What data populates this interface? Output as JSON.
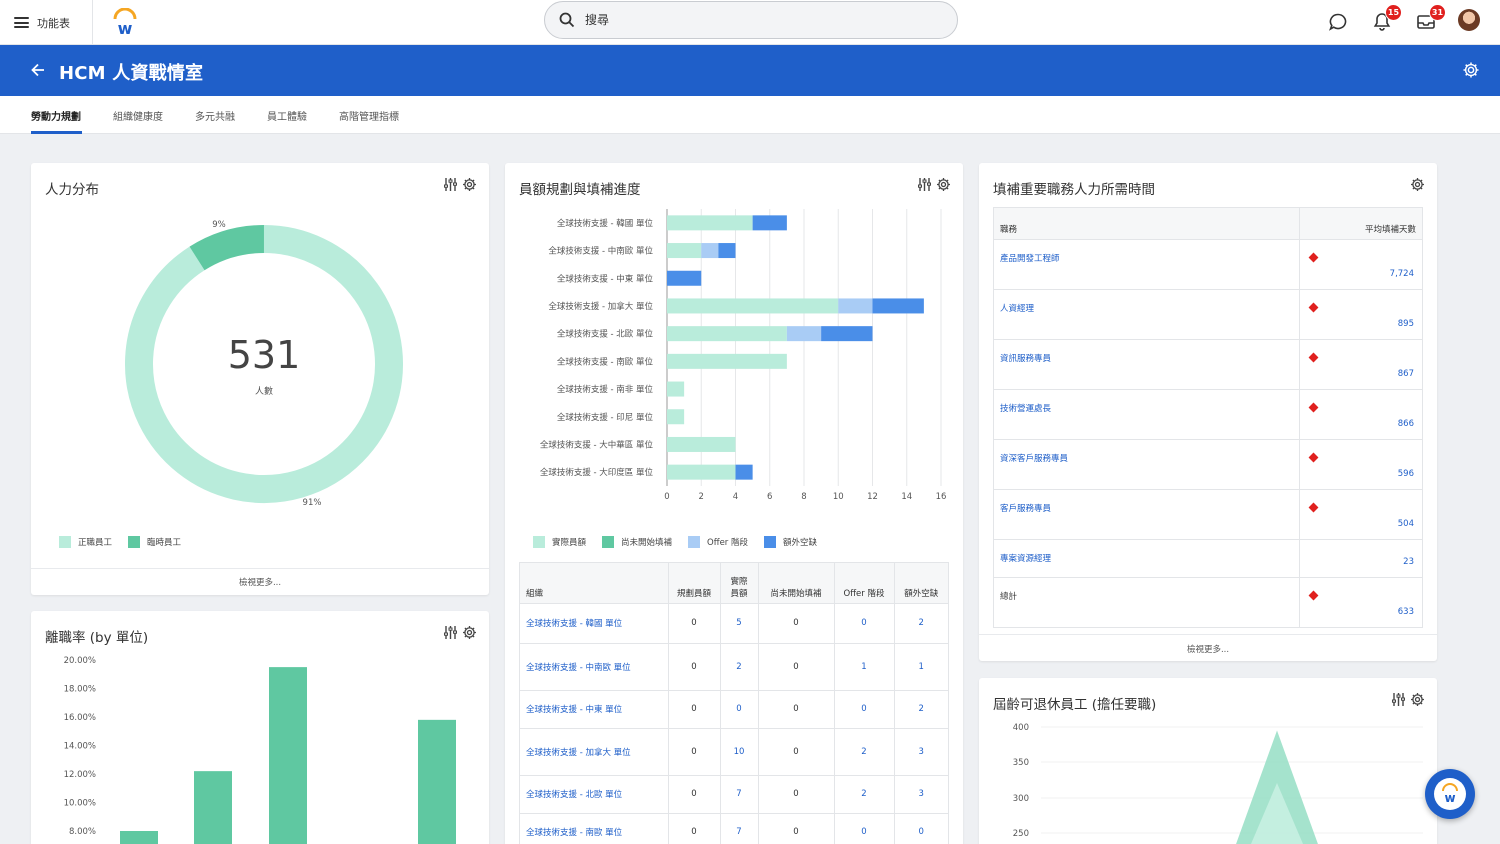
{
  "topbar": {
    "menu_label": "功能表",
    "search_placeholder": "搜尋",
    "notifications_count": "15",
    "inbox_count": "31"
  },
  "header": {
    "title": "HCM 人資戰情室"
  },
  "tabs": [
    {
      "label": "勞動力規劃",
      "active": true
    },
    {
      "label": "組織健康度"
    },
    {
      "label": "多元共融"
    },
    {
      "label": "員工體驗"
    },
    {
      "label": "高階管理指標"
    }
  ],
  "headcount": {
    "title": "人力分布",
    "total": "531",
    "total_label": "人數",
    "slices": [
      {
        "name": "正職員工",
        "pct": 91,
        "label": "91%",
        "color": "#b9ecdb"
      },
      {
        "name": "臨時員工",
        "pct": 9,
        "label": "9%",
        "color": "#5fc8a1"
      }
    ],
    "more": "檢視更多..."
  },
  "hiring": {
    "title": "員額規劃與填補進度",
    "chart_data": {
      "type": "bar",
      "orientation": "horizontal",
      "stacked": true,
      "categories": [
        "全球技術支援 - 韓國 單位",
        "全球技術支援 - 中南歐 單位",
        "全球技術支援 - 中東 單位",
        "全球技術支援 - 加拿大 單位",
        "全球技術支援 - 北歐 單位",
        "全球技術支援 - 南歐 單位",
        "全球技術支援 - 南非 單位",
        "全球技術支援 - 印尼 單位",
        "全球技術支援 - 大中華區 單位",
        "全球技術支援 - 大印度區 單位"
      ],
      "series": [
        {
          "name": "實際員額",
          "color": "#b9ecdb",
          "values": [
            5,
            2,
            0,
            10,
            7,
            7,
            1,
            1,
            4,
            4
          ]
        },
        {
          "name": "尚未開始填補",
          "color": "#5fc8a1",
          "values": [
            0,
            0,
            0,
            0,
            0,
            0,
            0,
            0,
            0,
            0
          ]
        },
        {
          "name": "Offer 階段",
          "color": "#a9ccf5",
          "values": [
            0,
            1,
            0,
            2,
            2,
            0,
            0,
            0,
            0,
            0
          ]
        },
        {
          "name": "額外空缺",
          "color": "#4a8ee8",
          "values": [
            2,
            1,
            2,
            3,
            3,
            0,
            0,
            0,
            0,
            1
          ]
        }
      ],
      "xticks": [
        0,
        2,
        4,
        6,
        8,
        10,
        12,
        14,
        16
      ],
      "xlim": [
        0,
        16
      ],
      "grid": true,
      "legend": "bottom"
    },
    "table": {
      "headers": [
        "組織",
        "規劃員額",
        "實際員額",
        "尚未開始填補",
        "Offer 階段",
        "額外空缺"
      ],
      "rows": [
        [
          "全球技術支援 - 韓國 單位",
          "0",
          "5",
          "0",
          "0",
          "2"
        ],
        [
          "全球技術支援 - 中南歐 單位",
          "0",
          "2",
          "0",
          "1",
          "1"
        ],
        [
          "全球技術支援 - 中東 單位",
          "0",
          "0",
          "0",
          "0",
          "2"
        ],
        [
          "全球技術支援 - 加拿大 單位",
          "0",
          "10",
          "0",
          "2",
          "3"
        ],
        [
          "全球技術支援 - 北歐 單位",
          "0",
          "7",
          "0",
          "2",
          "3"
        ],
        [
          "全球技術支援 - 南歐 單位",
          "0",
          "7",
          "0",
          "0",
          "0"
        ]
      ]
    }
  },
  "timetofill": {
    "title": "填補重要職務人力所需時間",
    "headers": [
      "職務",
      "平均填補天數"
    ],
    "rows": [
      {
        "role": "產品開發工程師",
        "days": "7,724",
        "flag": true
      },
      {
        "role": "人資經理",
        "days": "895",
        "flag": true
      },
      {
        "role": "資訊服務專員",
        "days": "867",
        "flag": true
      },
      {
        "role": "技術營運處長",
        "days": "866",
        "flag": true
      },
      {
        "role": "資深客戶服務專員",
        "days": "596",
        "flag": true
      },
      {
        "role": "客戶服務專員",
        "days": "504",
        "flag": true
      },
      {
        "role": "專案資源經理",
        "days": "23",
        "flag": false
      },
      {
        "role": "總計",
        "days": "633",
        "flag": true
      }
    ],
    "more": "檢視更多..."
  },
  "attrition": {
    "title": "離職率 (by 單位)",
    "chart_data": {
      "type": "bar",
      "categories": [
        "",
        "",
        "",
        "",
        ""
      ],
      "values": [
        8.0,
        12.2,
        19.5,
        null,
        15.8
      ],
      "yticks": [
        "8.00%",
        "10.00%",
        "12.00%",
        "14.00%",
        "16.00%",
        "18.00%",
        "20.00%"
      ],
      "ylim": [
        7.0,
        20.5
      ],
      "color": "#5fc8a1"
    }
  },
  "retire": {
    "title": "屆齡可退休員工 (擔任要職)",
    "chart_data": {
      "type": "area",
      "yticks": [
        "250",
        "300",
        "350",
        "400"
      ],
      "ylim": [
        240,
        400
      ],
      "peak": 395
    }
  }
}
